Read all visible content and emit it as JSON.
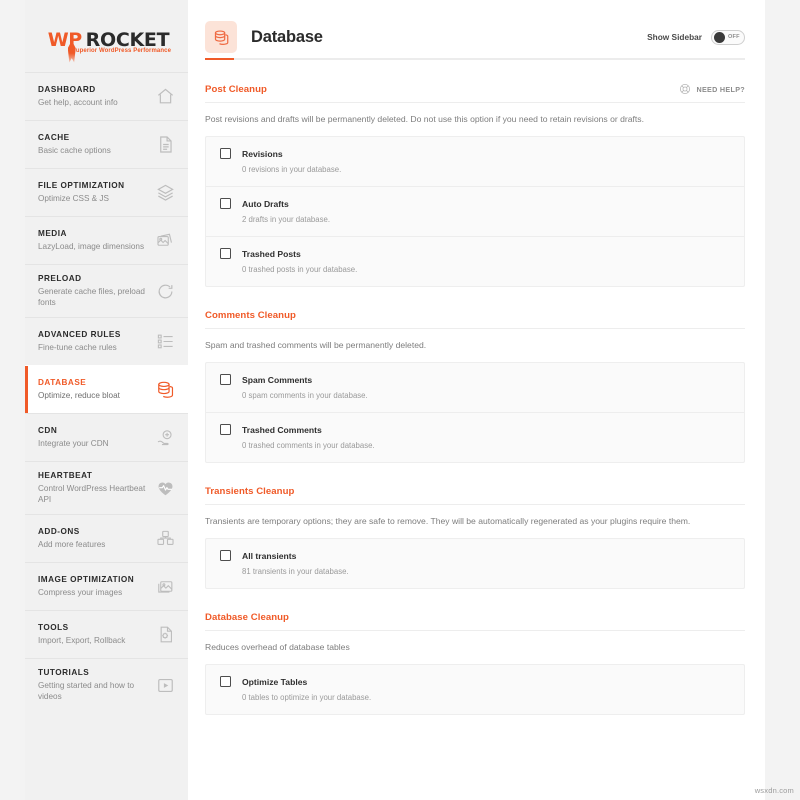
{
  "brand": {
    "logo_primary": "WP",
    "logo_secondary": "ROCKET",
    "logo_tagline": "Superior WordPress Performance",
    "accent_color": "#f05a28"
  },
  "sidebar": {
    "items": [
      {
        "title": "DASHBOARD",
        "subtitle": "Get help, account info",
        "icon": "home-icon",
        "active": false
      },
      {
        "title": "CACHE",
        "subtitle": "Basic cache options",
        "icon": "document-icon",
        "active": false
      },
      {
        "title": "FILE OPTIMIZATION",
        "subtitle": "Optimize CSS & JS",
        "icon": "layers-icon",
        "active": false
      },
      {
        "title": "MEDIA",
        "subtitle": "LazyLoad, image dimensions",
        "icon": "photos-icon",
        "active": false
      },
      {
        "title": "PRELOAD",
        "subtitle": "Generate cache files, preload fonts",
        "icon": "refresh-icon",
        "active": false
      },
      {
        "title": "ADVANCED RULES",
        "subtitle": "Fine-tune cache rules",
        "icon": "list-icon",
        "active": false
      },
      {
        "title": "DATABASE",
        "subtitle": "Optimize, reduce bloat",
        "icon": "database-icon",
        "active": true
      },
      {
        "title": "CDN",
        "subtitle": "Integrate your CDN",
        "icon": "cloud-hand-icon",
        "active": false
      },
      {
        "title": "HEARTBEAT",
        "subtitle": "Control WordPress Heartbeat API",
        "icon": "heart-pulse-icon",
        "active": false
      },
      {
        "title": "ADD-ONS",
        "subtitle": "Add more features",
        "icon": "blocks-icon",
        "active": false
      },
      {
        "title": "IMAGE OPTIMIZATION",
        "subtitle": "Compress your images",
        "icon": "image-stack-icon",
        "active": false
      },
      {
        "title": "TOOLS",
        "subtitle": "Import, Export, Rollback",
        "icon": "file-gear-icon",
        "active": false
      },
      {
        "title": "TUTORIALS",
        "subtitle": "Getting started and how to videos",
        "icon": "video-icon",
        "active": false
      }
    ]
  },
  "header": {
    "icon": "database-icon",
    "title": "Database",
    "sidebar_toggle_label": "Show Sidebar",
    "sidebar_toggle_state": "OFF"
  },
  "need_help": {
    "label": "NEED HELP?",
    "icon": "lifebuoy-icon"
  },
  "sections": [
    {
      "title": "Post Cleanup",
      "description": "Post revisions and drafts will be permanently deleted. Do not use this option if you need to retain revisions or drafts.",
      "has_need_help": true,
      "options": [
        {
          "label": "Revisions",
          "count_text": "0 revisions in your database.",
          "checked": false
        },
        {
          "label": "Auto Drafts",
          "count_text": "2 drafts in your database.",
          "checked": false
        },
        {
          "label": "Trashed Posts",
          "count_text": "0 trashed posts in your database.",
          "checked": false
        }
      ]
    },
    {
      "title": "Comments Cleanup",
      "description": "Spam and trashed comments will be permanently deleted.",
      "has_need_help": false,
      "options": [
        {
          "label": "Spam Comments",
          "count_text": "0 spam comments in your database.",
          "checked": false
        },
        {
          "label": "Trashed Comments",
          "count_text": "0 trashed comments in your database.",
          "checked": false
        }
      ]
    },
    {
      "title": "Transients Cleanup",
      "description": "Transients are temporary options; they are safe to remove. They will be automatically regenerated as your plugins require them.",
      "has_need_help": false,
      "options": [
        {
          "label": "All transients",
          "count_text": "81 transients in your database.",
          "checked": false
        }
      ]
    },
    {
      "title": "Database Cleanup",
      "description": "Reduces overhead of database tables",
      "has_need_help": false,
      "options": [
        {
          "label": "Optimize Tables",
          "count_text": "0 tables to optimize in your database.",
          "checked": false
        }
      ]
    }
  ],
  "watermark": "wsxdn.com"
}
